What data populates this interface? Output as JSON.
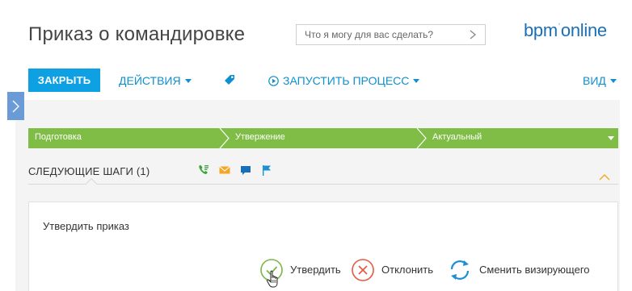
{
  "page": {
    "title": "Приказ о командировке"
  },
  "search": {
    "placeholder": "Что я могу для вас сделать?"
  },
  "logo": {
    "part1": "bpm",
    "mark": "'",
    "part2": "online"
  },
  "toolbar": {
    "close_label": "ЗАКРЫТЬ",
    "actions_label": "ДЕЙСТВИЯ",
    "run_process_label": "ЗАПУСТИТЬ ПРОЦЕСС",
    "view_label": "ВИД"
  },
  "stages": [
    "Подготовка",
    "Утвержение",
    "Актуальный"
  ],
  "next_steps": {
    "title": "СЛЕДУЮЩИЕ ШАГИ (1)",
    "icons": [
      "phone-icon",
      "email-icon",
      "chat-icon",
      "flag-icon"
    ]
  },
  "task": {
    "title": "Утвердить приказ",
    "approve_label": "Утвердить",
    "reject_label": "Отклонить",
    "change_approver_label": "Сменить визирующего"
  },
  "colors": {
    "accent": "#0da0e3",
    "link": "#0e8fcf",
    "stage_bar": "#7fbd47",
    "approve": "#7ab648",
    "reject": "#e8593f",
    "change": "#1b8fd6",
    "flag_highlight": "#f5a623"
  }
}
